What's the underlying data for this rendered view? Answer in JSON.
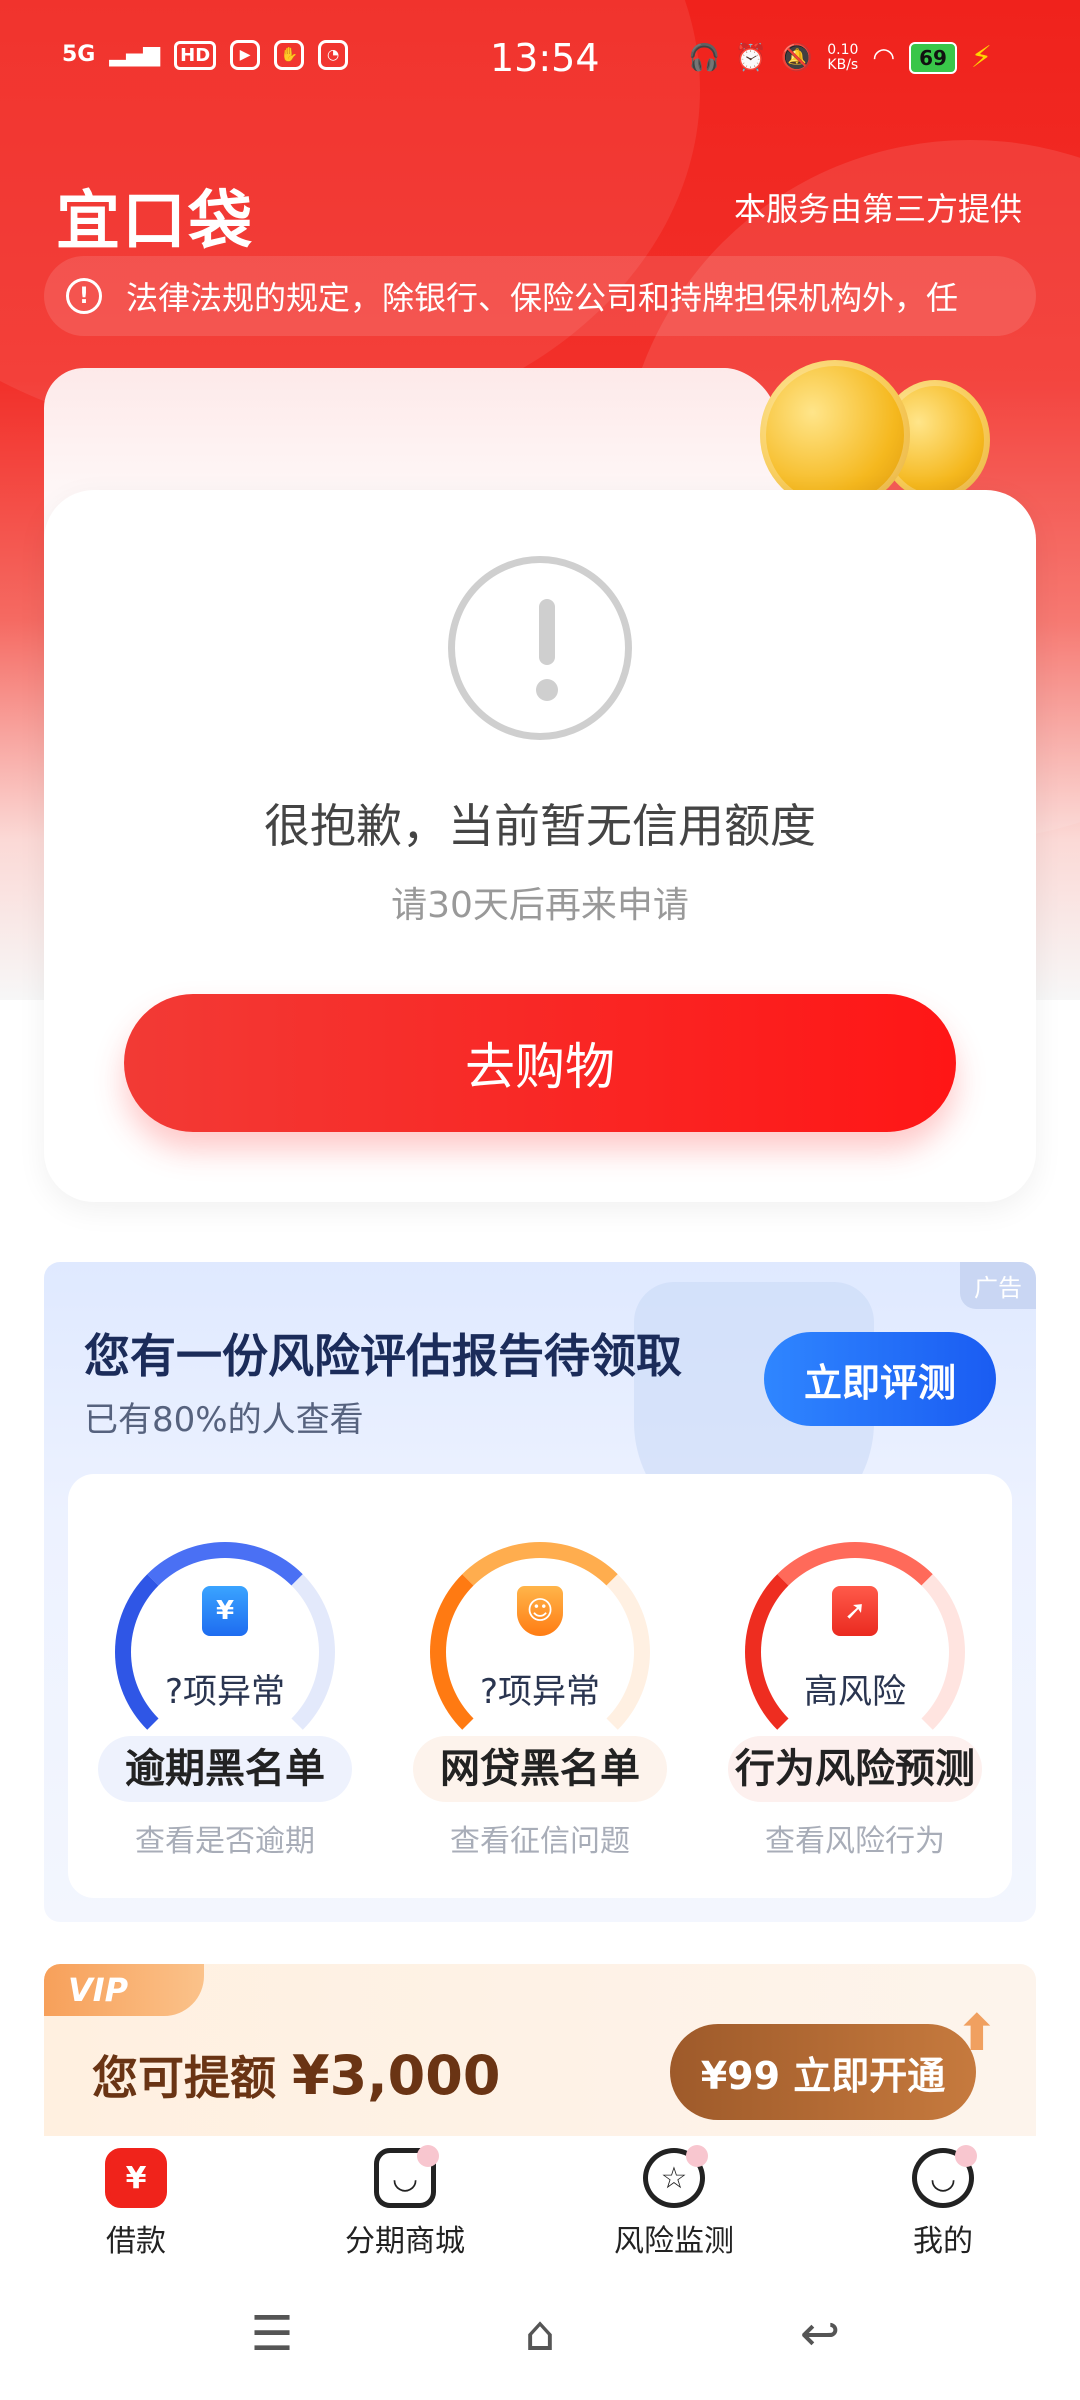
{
  "status_bar": {
    "signal": "5G",
    "hd": "HD",
    "time": "13:54",
    "speed_value": "0.10",
    "speed_unit": "KB/s",
    "battery": "69"
  },
  "header": {
    "logo": "宜口袋",
    "provider": "本服务由第三方提供"
  },
  "notice": {
    "text": "法律法规的规定，除银行、保险公司和持牌担保机构外，任"
  },
  "credit_card": {
    "title": "很抱歉，当前暂无信用额度",
    "subtitle": "请30天后再来申请",
    "button": "去购物"
  },
  "risk_report": {
    "ad_tag": "广告",
    "title": "您有一份风险评估报告待领取",
    "subtitle": "已有80%的人查看",
    "button": "立即评测",
    "items": [
      {
        "gauge_label": "?项异常",
        "name": "逾期黑名单",
        "desc": "查看是否逾期",
        "icon": "yen-icon",
        "color": "#2f56e6"
      },
      {
        "gauge_label": "?项异常",
        "name": "网贷黑名单",
        "desc": "查看征信问题",
        "icon": "person-shield-icon",
        "color": "#ff7a12"
      },
      {
        "gauge_label": "高风险",
        "name": "行为风险预测",
        "desc": "查看风险行为",
        "icon": "cursor-icon",
        "color": "#ee2d20"
      }
    ]
  },
  "vip": {
    "tag": "VIP",
    "text": "您可提额",
    "amount": "¥3,000",
    "button": "¥99 立即开通"
  },
  "bottom_nav": [
    {
      "label": "借款",
      "icon": "yen-icon",
      "active": true
    },
    {
      "label": "分期商城",
      "icon": "bag-icon",
      "active": false
    },
    {
      "label": "风险监测",
      "icon": "star-icon",
      "active": false
    },
    {
      "label": "我的",
      "icon": "smile-icon",
      "active": false
    }
  ],
  "colors": {
    "brand_red": "#f0231b",
    "blue_accent": "#1a5cf2",
    "vip_brown": "#9e5a2a"
  }
}
